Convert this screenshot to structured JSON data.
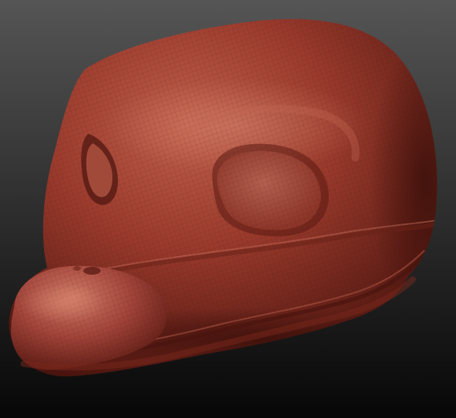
{
  "scene": {
    "subject": "sculpt-mesh-head",
    "background": {
      "top_color": "#555555",
      "bottom_color": "#070707"
    },
    "material": {
      "base_color": "#9a3a2c",
      "highlight_color": "#c8705e",
      "shadow_color": "#4a140e",
      "wireframe_color": "#3d100b"
    },
    "wireframe_visible": true
  }
}
